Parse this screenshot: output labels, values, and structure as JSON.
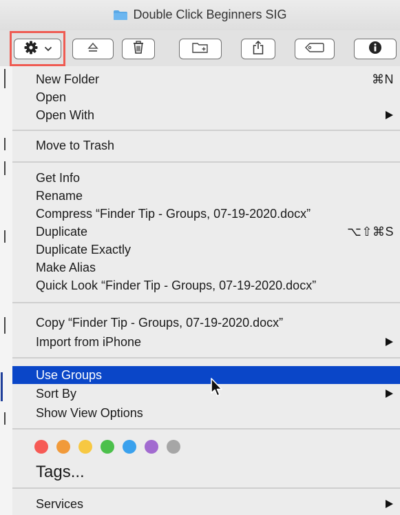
{
  "window": {
    "title": "Double Click Beginners SIG",
    "folder_color": "#5aa8e6"
  },
  "toolbar": {
    "gear_chevron": "⌄",
    "highlight_color": "#ef5b52"
  },
  "menu": {
    "highlight_color": "#0a46c8",
    "items": [
      {
        "label": "New Folder",
        "shortcut": "⌘N"
      },
      {
        "label": "Open"
      },
      {
        "label": "Open With",
        "submenu": true
      },
      {
        "label": "Move to Trash"
      },
      {
        "label": "Get Info"
      },
      {
        "label": "Rename"
      },
      {
        "label": "Compress “Finder Tip - Groups, 07-19-2020.docx”"
      },
      {
        "label": "Duplicate",
        "shortcut": "⌥⇧⌘S"
      },
      {
        "label": "Duplicate Exactly"
      },
      {
        "label": "Make Alias"
      },
      {
        "label": "Quick Look “Finder Tip - Groups, 07-19-2020.docx”"
      },
      {
        "label": "Copy “Finder Tip - Groups, 07-19-2020.docx”"
      },
      {
        "label": "Import from iPhone",
        "submenu": true
      },
      {
        "label": "Use Groups",
        "highlighted": true
      },
      {
        "label": "Sort By",
        "submenu": true
      },
      {
        "label": "Show View Options"
      },
      {
        "label": "Services",
        "submenu": true
      }
    ],
    "tags": {
      "label": "Tags...",
      "colors": [
        "#f65a55",
        "#f19a3a",
        "#f7c842",
        "#4cc04b",
        "#3aa1ed",
        "#a26bd0",
        "#a6a6a6"
      ]
    }
  }
}
